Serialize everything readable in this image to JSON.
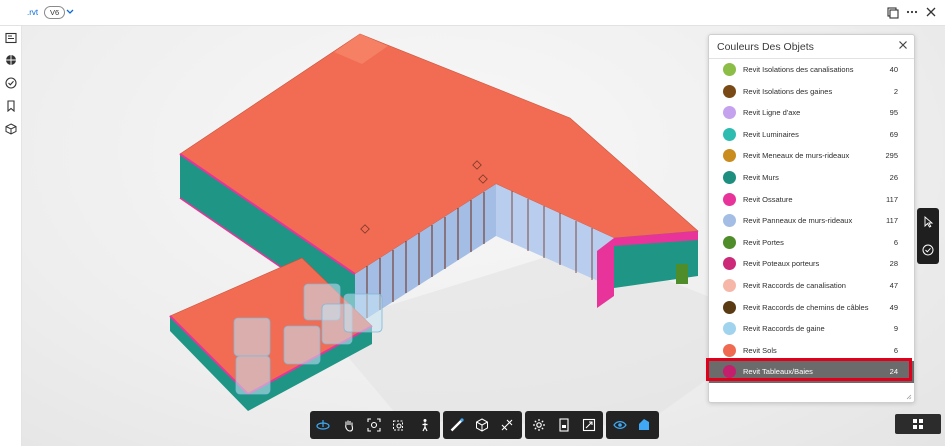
{
  "header": {
    "file_name": ".rvt",
    "version": "V6"
  },
  "panel": {
    "title": "Couleurs Des Objets",
    "items": [
      {
        "label": "Revit Isolations des canalisations",
        "count": "40",
        "color": "#8cbd47"
      },
      {
        "label": "Revit Isolations des gaines",
        "count": "2",
        "color": "#7a4a16"
      },
      {
        "label": "Revit Ligne d'axe",
        "count": "95",
        "color": "#c5a2ee"
      },
      {
        "label": "Revit Luminaires",
        "count": "69",
        "color": "#2fbcb0"
      },
      {
        "label": "Revit Meneaux de murs-rideaux",
        "count": "295",
        "color": "#c98c1d"
      },
      {
        "label": "Revit Murs",
        "count": "26",
        "color": "#1e8e7e"
      },
      {
        "label": "Revit Ossature",
        "count": "117",
        "color": "#e8349a"
      },
      {
        "label": "Revit Panneaux de murs-rideaux",
        "count": "117",
        "color": "#a4bde4"
      },
      {
        "label": "Revit Portes",
        "count": "6",
        "color": "#4f8c2a"
      },
      {
        "label": "Revit Poteaux porteurs",
        "count": "28",
        "color": "#cc2a78"
      },
      {
        "label": "Revit Raccords de canalisation",
        "count": "47",
        "color": "#f7b7a8"
      },
      {
        "label": "Revit Raccords de chemins de câbles",
        "count": "49",
        "color": "#5a3a12"
      },
      {
        "label": "Revit Raccords de gaine",
        "count": "9",
        "color": "#9fd3ee"
      },
      {
        "label": "Revit Sols",
        "count": "6",
        "color": "#ef6a50"
      },
      {
        "label": "Revit Tableaux/Baies",
        "count": "24",
        "color": "#c41f6c"
      }
    ]
  },
  "colors": {
    "roof": "#f26b53",
    "wall_teal": "#1e9585",
    "frame_pink": "#e8349a",
    "glass": "#a4bde4",
    "selection_outline": "#e0001b",
    "toolbar_bg": "#232323"
  }
}
